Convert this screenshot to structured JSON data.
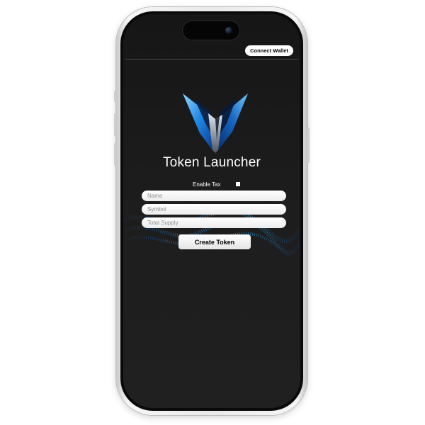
{
  "header": {
    "connect_wallet_label": "Connect Wallet"
  },
  "main": {
    "title": "Token Launcher",
    "enable_tax_label": "Enable Tax",
    "enable_tax_checked": false,
    "name_placeholder": "Name",
    "symbol_placeholder": "Symbol",
    "total_supply_placeholder": "Total Supply",
    "create_token_label": "Create Token"
  },
  "icons": {
    "logo": "v-shaped-blue-logo",
    "camera": "camera-icon"
  },
  "colors": {
    "screen_background": "#1a1a1a",
    "logo_blue": "#1e88e5",
    "logo_light": "#6ec6ff",
    "button_background": "#ffffff",
    "text_light": "#ffffff"
  }
}
